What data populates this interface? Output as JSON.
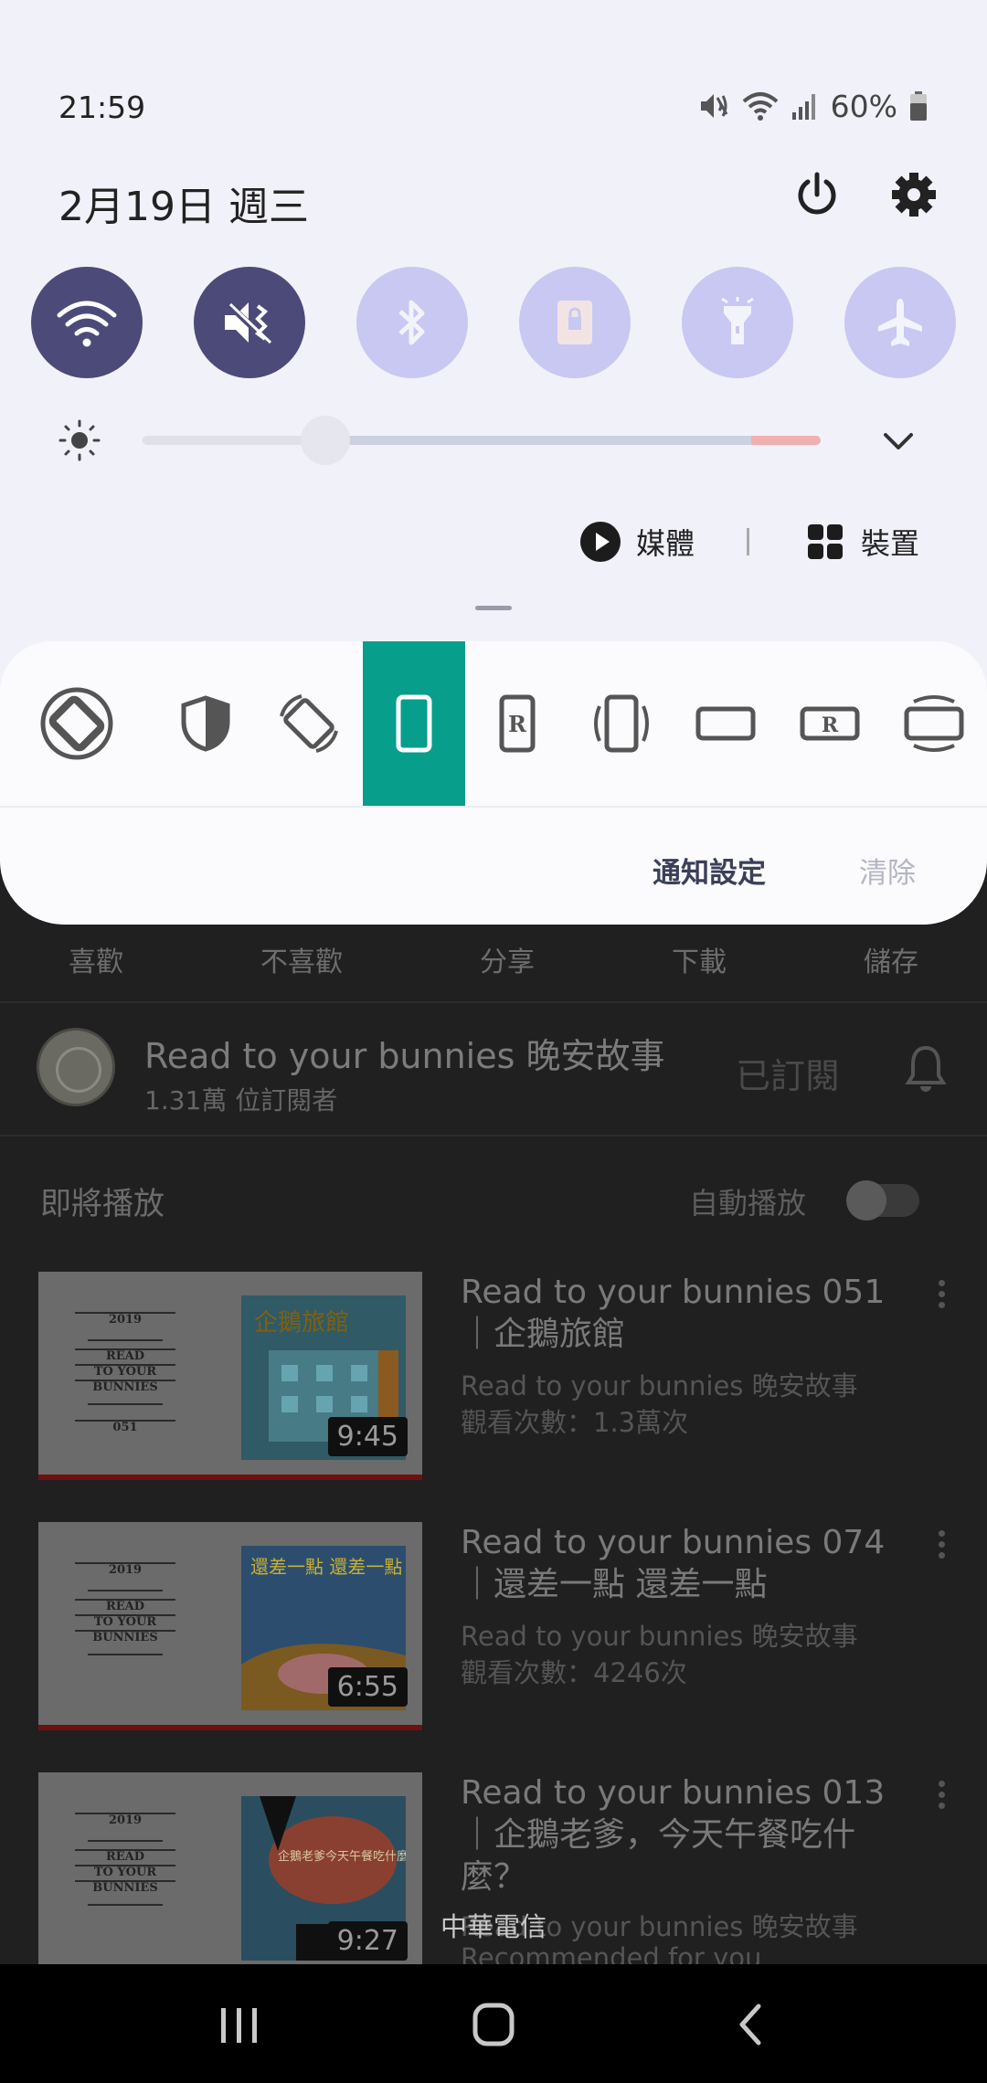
{
  "status_bar": {
    "time": "21:59",
    "battery": "60%"
  },
  "quick_panel": {
    "date": "2月19日 週三",
    "tiles": [
      {
        "name": "Wi-Fi",
        "state": "on"
      },
      {
        "name": "Mute",
        "state": "on"
      },
      {
        "name": "Bluetooth",
        "state": "off"
      },
      {
        "name": "Sound mode",
        "state": "off"
      },
      {
        "name": "Flashlight",
        "state": "off"
      },
      {
        "name": "Airplane mode",
        "state": "off"
      }
    ],
    "brightness_level": 0.27,
    "media_label": "媒體",
    "devices_label": "裝置"
  },
  "rotation_options": {
    "items": [
      "auto-rotate",
      "shield",
      "rotate",
      "portrait",
      "portrait-locked",
      "portrait-vibrate",
      "landscape",
      "landscape-locked",
      "landscape-tv"
    ],
    "selected_index": 3
  },
  "notification_actions": {
    "settings": "通知設定",
    "clear": "清除"
  },
  "background_app": {
    "actions": [
      "喜歡",
      "不喜歡",
      "分享",
      "下載",
      "儲存"
    ],
    "channel": {
      "name": "Read to your bunnies 晚安故事",
      "subscribers": "1.31萬 位訂閱者",
      "subscribed_label": "已訂閱"
    },
    "up_next": "即將播放",
    "autoplay": "自動播放",
    "videos": [
      {
        "title": "Read to your bunnies 051｜企鵝旅館",
        "channel": "Read to your bunnies 晚安故事",
        "views": "觀看次數：1.3萬次",
        "duration": "9:45",
        "cover_title": "企鵝旅館"
      },
      {
        "title": "Read to your bunnies 074｜還差一點 還差一點",
        "channel": "Read to your bunnies 晚安故事",
        "views": "觀看次數：4246次",
        "duration": "6:55",
        "cover_title": "還差一點 還差一點"
      },
      {
        "title": "Read to your bunnies 013｜企鵝老爹，今天午餐吃什麼？",
        "channel": "Read to your bunnies 晚安故事",
        "views": "Recommended for you",
        "duration": "9:27",
        "cover_title": "企鵝老爹今天午餐吃什麼"
      }
    ],
    "thumb_text": [
      "2019",
      "READ",
      "TO YOUR",
      "BUNNIES",
      "051"
    ]
  },
  "carrier": "中華電信",
  "colors": {
    "accent": "#079e8c",
    "tile_on": "#4b4a78",
    "tile_off": "#c8c8f2",
    "panel_bg": "#f1f1f9"
  }
}
